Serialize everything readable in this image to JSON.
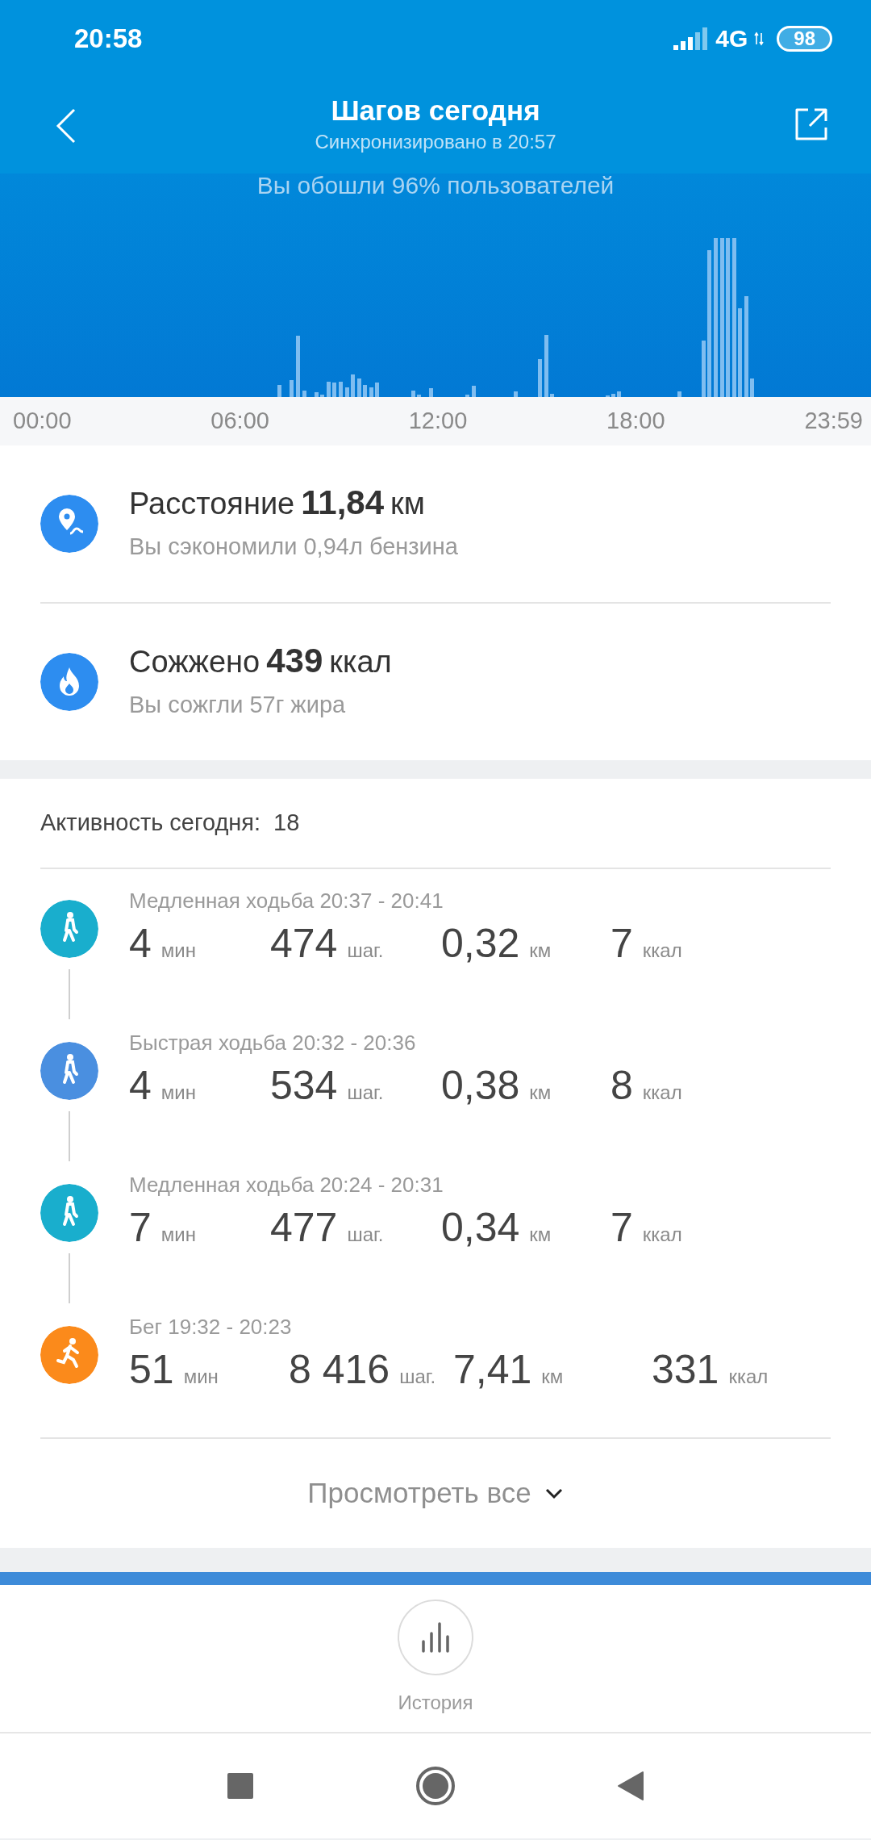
{
  "status_bar": {
    "time": "20:58",
    "network": "4G",
    "battery": "98"
  },
  "header": {
    "title": "Шагов сегодня",
    "subtitle": "Синхронизировано в 20:57"
  },
  "chart": {
    "caption": "Вы обошли 96% пользователей",
    "x_labels": [
      "00:00",
      "06:00",
      "12:00",
      "18:00",
      "23:59"
    ]
  },
  "summary": [
    {
      "kind": "distance",
      "label": "Расстояние",
      "value": "11,84",
      "unit": "км",
      "note": "Вы сэкономили 0,94л бензина"
    },
    {
      "kind": "calories",
      "label": "Сожжено",
      "value": "439",
      "unit": "ккал",
      "note": "Вы сожгли 57г жира"
    }
  ],
  "activity": {
    "label": "Активность сегодня:",
    "count": "18",
    "items": [
      {
        "kind": "walk",
        "color": "#19aecd",
        "title": "Медленная ходьба 20:37 - 20:41",
        "stats": [
          {
            "value": "4",
            "unit": "мин"
          },
          {
            "value": "474",
            "unit": "шаг."
          },
          {
            "value": "0,32",
            "unit": "км"
          },
          {
            "value": "7",
            "unit": "ккал"
          }
        ]
      },
      {
        "kind": "walk",
        "color": "#4a8fe0",
        "title": "Быстрая ходьба 20:32 - 20:36",
        "stats": [
          {
            "value": "4",
            "unit": "мин"
          },
          {
            "value": "534",
            "unit": "шаг."
          },
          {
            "value": "0,38",
            "unit": "км"
          },
          {
            "value": "8",
            "unit": "ккал"
          }
        ]
      },
      {
        "kind": "walk",
        "color": "#19aecd",
        "title": "Медленная ходьба 20:24 - 20:31",
        "stats": [
          {
            "value": "7",
            "unit": "мин"
          },
          {
            "value": "477",
            "unit": "шаг."
          },
          {
            "value": "0,34",
            "unit": "км"
          },
          {
            "value": "7",
            "unit": "ккал"
          }
        ]
      },
      {
        "kind": "run",
        "color": "#fb8a1b",
        "title": "Бег 19:32 - 20:23",
        "stats": [
          {
            "value": "51",
            "unit": "мин"
          },
          {
            "value": "8 416",
            "unit": "шаг."
          },
          {
            "value": "7,41",
            "unit": "км"
          },
          {
            "value": "331",
            "unit": "ккал"
          }
        ]
      }
    ],
    "view_all": "Просмотреть все"
  },
  "bottom_nav": {
    "label": "История"
  }
}
